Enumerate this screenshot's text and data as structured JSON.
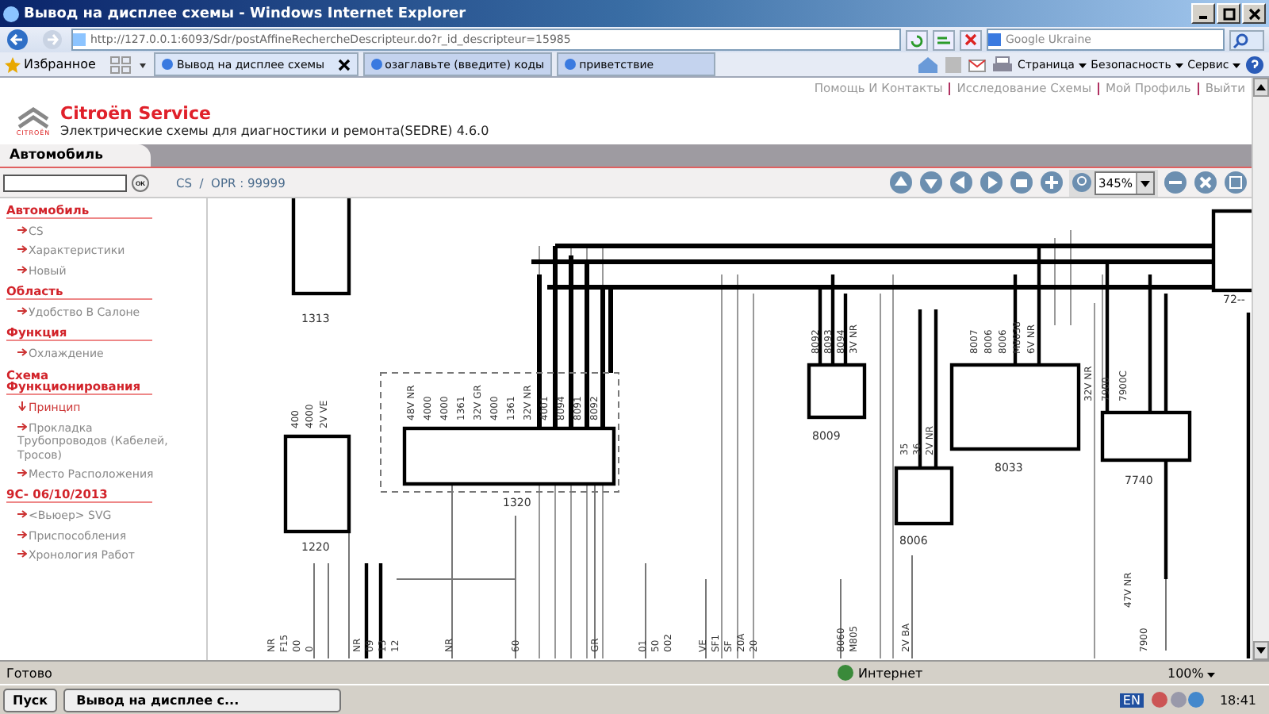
{
  "window": {
    "title": "Вывод на дисплее схемы - Windows Internet Explorer"
  },
  "address_bar": {
    "url": "http://127.0.0.1:6093/Sdr/postAffineRechercheDescripteur.do?r_id_descripteur=15985",
    "search_placeholder": "Google Ukraine"
  },
  "favorites_label": "Избранное",
  "browser_tabs": [
    {
      "label": "Вывод на дисплее схемы",
      "selected": true
    },
    {
      "label": "озаглавьте (введите) коды",
      "selected": false
    },
    {
      "label": "приветствие",
      "selected": false
    }
  ],
  "command_bar": [
    "Страница",
    "Безопасность",
    "Сервис"
  ],
  "top_links": [
    "Помощь И Контакты",
    "Исследование Схемы",
    "Мой Профиль",
    "Выйти"
  ],
  "brand": {
    "name": "Citroën Service",
    "logo_text": "CITROËN",
    "subtitle": "Электрические схемы для диагностики и ремонта(SEDRE) 4.6.0"
  },
  "section_tab": "Автомобиль",
  "toolbar": {
    "ok_label": "OK",
    "breadcrumb": "CS  /  OPR : 99999",
    "zoom": "345%"
  },
  "sidebar": [
    {
      "title": "Автомобиль",
      "items": [
        {
          "label": "CS",
          "selected": false
        },
        {
          "label": "Характеристики",
          "selected": false
        },
        {
          "label": "Новый",
          "selected": false
        }
      ]
    },
    {
      "title": "Область",
      "items": [
        {
          "label": "Удобство В Салоне",
          "selected": false
        }
      ]
    },
    {
      "title": "Функция",
      "items": [
        {
          "label": "Охлаждение",
          "selected": false
        }
      ]
    },
    {
      "title": "Схема Функционирования",
      "items": [
        {
          "label": "Принцип",
          "selected": true
        },
        {
          "label": "Прокладка Трубопроводов (Кабелей, Тросов)",
          "selected": false
        },
        {
          "label": "Место Расположения",
          "selected": false
        }
      ]
    },
    {
      "title": "9C- 06/10/2013",
      "items": [
        {
          "label": "<Вьюер> SVG",
          "selected": false
        },
        {
          "label": "Приспособления",
          "selected": false
        },
        {
          "label": "Хронология Работ",
          "selected": false
        }
      ]
    }
  ],
  "diagram": {
    "components": [
      {
        "label": "1313"
      },
      {
        "label": "1220",
        "pins": [
          "400",
          "4000",
          "2V VE"
        ]
      },
      {
        "label": "1320",
        "pins": [
          "48V NR",
          "4000",
          "4000",
          "1361",
          "32V GR",
          "4000",
          "1361",
          "32V NR",
          "4001",
          "8094",
          "8091",
          "8092"
        ]
      },
      {
        "label": "8009",
        "pins": [
          "8092",
          "8093",
          "8094",
          "3V NR"
        ]
      },
      {
        "label": "8006",
        "pins": [
          "35",
          "36",
          "2V NR"
        ]
      },
      {
        "label": "8033",
        "pins": [
          "8007",
          "8006",
          "8006",
          "M8038",
          "6V NR"
        ]
      },
      {
        "label": "7740",
        "pins": [
          "32V NR",
          "7900",
          "7900C"
        ]
      },
      {
        "label": "72--"
      }
    ],
    "bottom_labels": [
      "NR",
      "F15",
      "00",
      "0",
      "NR",
      "09",
      "13",
      "12",
      "NR",
      "60",
      "GR",
      "01",
      "50",
      "002",
      "VE",
      "SF1",
      "SF",
      "20A",
      "20",
      "8060",
      "M805",
      "2V BA",
      "47V NR",
      "7900"
    ]
  },
  "status_bar": {
    "text": "Готово",
    "zone": "Интернет",
    "zoom": "100%"
  },
  "taskbar": {
    "start": "Пуск",
    "task": "Вывод на дисплее с...",
    "language": "EN",
    "clock": "18:41"
  }
}
